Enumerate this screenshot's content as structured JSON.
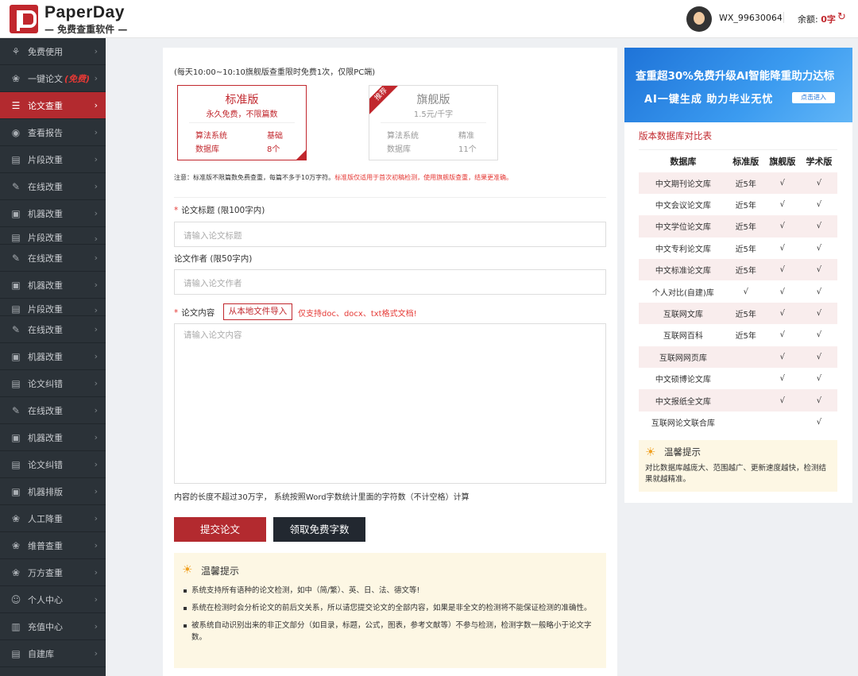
{
  "header": {
    "brand": "PaperDay",
    "brand_sub": "— 免费查重软件 —",
    "username": "WX_99630064",
    "balance_label": "余额:",
    "balance_value": "0字"
  },
  "sidebar": [
    {
      "label": "免费使用",
      "icon": "plant-icon"
    },
    {
      "label": "一键论文",
      "free": "(免费)",
      "icon": "bulb-icon"
    },
    {
      "label": "论文查重",
      "icon": "doc-check-icon",
      "active": true
    },
    {
      "label": "查看报告",
      "icon": "eye-icon"
    },
    {
      "label": "片段改重",
      "icon": "puzzle-icon"
    },
    {
      "label": "在线改重",
      "icon": "edit-icon"
    },
    {
      "label": "机器改重",
      "icon": "monitor-icon"
    },
    {
      "label": "片段改重",
      "icon": "puzzle-icon",
      "clip": true
    },
    {
      "label": "在线改重",
      "icon": "edit-icon"
    },
    {
      "label": "机器改重",
      "icon": "monitor-icon"
    },
    {
      "label": "片段改重",
      "icon": "puzzle-icon",
      "clip": true
    },
    {
      "label": "在线改重",
      "icon": "edit-icon"
    },
    {
      "label": "机器改重",
      "icon": "monitor-icon"
    },
    {
      "label": "论文纠错",
      "icon": "puzzle-icon"
    },
    {
      "label": "在线改重",
      "icon": "edit-icon"
    },
    {
      "label": "机器改重",
      "icon": "monitor-icon"
    },
    {
      "label": "论文纠错",
      "icon": "puzzle-icon"
    },
    {
      "label": "机器排版",
      "icon": "monitor-icon"
    },
    {
      "label": "人工降重",
      "icon": "bulb-icon"
    },
    {
      "label": "维普查重",
      "icon": "bulb-icon"
    },
    {
      "label": "万方查重",
      "icon": "bulb-icon"
    },
    {
      "label": "个人中心",
      "icon": "user-icon"
    },
    {
      "label": "充值中心",
      "icon": "wallet-icon"
    },
    {
      "label": "自建库",
      "icon": "puzzle-icon"
    }
  ],
  "main": {
    "notice": "(每天10:00~10:10旗舰版查重限时免费1次，仅限PC端)",
    "cards": {
      "standard": {
        "title": "标准版",
        "sub": "永久免费，不限篇数",
        "algo_label": "算法系统",
        "algo_value": "基础",
        "db_label": "数据库",
        "db_value": "8个"
      },
      "flagship": {
        "ribbon": "推荐",
        "title": "旗舰版",
        "sub": "1.5元/千字",
        "algo_label": "算法系统",
        "algo_value": "精准",
        "db_label": "数据库",
        "db_value": "11个"
      }
    },
    "warning_prefix": "注意：标准版不限篇数免费查重，每篇不多于10万字符。",
    "warning_red": "标准版仅适用于首次初稿检测，使用旗舰版查重，结果更准确。",
    "title_label": "论文标题",
    "title_limit": "(限100字内)",
    "title_placeholder": "请输入论文标题",
    "author_label": "论文作者",
    "author_limit": "(限50字内)",
    "author_placeholder": "请输入论文作者",
    "content_label": "论文内容",
    "import_button": "从本地文件导入",
    "support_hint": "仅支持doc、docx、txt格式文档!",
    "content_placeholder": "请输入论文内容",
    "length_hint": "内容的长度不超过30万字， 系统按照Word字数统计里面的字符数（不计空格）计算",
    "submit_button": "提交论文",
    "free_words_button": "领取免费字数",
    "tips": {
      "title": "温馨提示",
      "items": [
        "系统支持所有语种的论文检测，如中（简/繁）、英、日、法、德文等!",
        "系统在检测时会分析论文的前后文关系，所以请您提交论文的全部内容，如果是非全文的检测将不能保证检测的准确性。",
        "被系统自动识别出来的非正文部分（如目录，标题，公式，图表，参考文献等）不参与检测，检测字数一般略小于论文字数。"
      ]
    }
  },
  "right": {
    "banner_line1": "查重超30%免费升级AI智能降重助力达标",
    "banner_line2": "AI一键生成  助力毕业无忧",
    "banner_button": "点击进入",
    "table_title": "版本数据库对比表",
    "headers": [
      "数据库",
      "标准版",
      "旗舰版",
      "学术版"
    ],
    "rows": [
      [
        "中文期刊论文库",
        "近5年",
        "√",
        "√"
      ],
      [
        "中文会议论文库",
        "近5年",
        "√",
        "√"
      ],
      [
        "中文学位论文库",
        "近5年",
        "√",
        "√"
      ],
      [
        "中文专利论文库",
        "近5年",
        "√",
        "√"
      ],
      [
        "中文标准论文库",
        "近5年",
        "√",
        "√"
      ],
      [
        "个人对比(自建)库",
        "√",
        "√",
        "√"
      ],
      [
        "互联网文库",
        "近5年",
        "√",
        "√"
      ],
      [
        "互联网百科",
        "近5年",
        "√",
        "√"
      ],
      [
        "互联网网页库",
        "",
        "√",
        "√"
      ],
      [
        "中文硕博论文库",
        "",
        "√",
        "√"
      ],
      [
        "中文报纸全文库",
        "",
        "√",
        "√"
      ],
      [
        "互联网论文联合库",
        "",
        "",
        "√"
      ]
    ],
    "tips_title": "温馨提示",
    "tips_text": "对比数据库越庞大、范围越广、更新速度越快，检测结果就越精准。"
  }
}
